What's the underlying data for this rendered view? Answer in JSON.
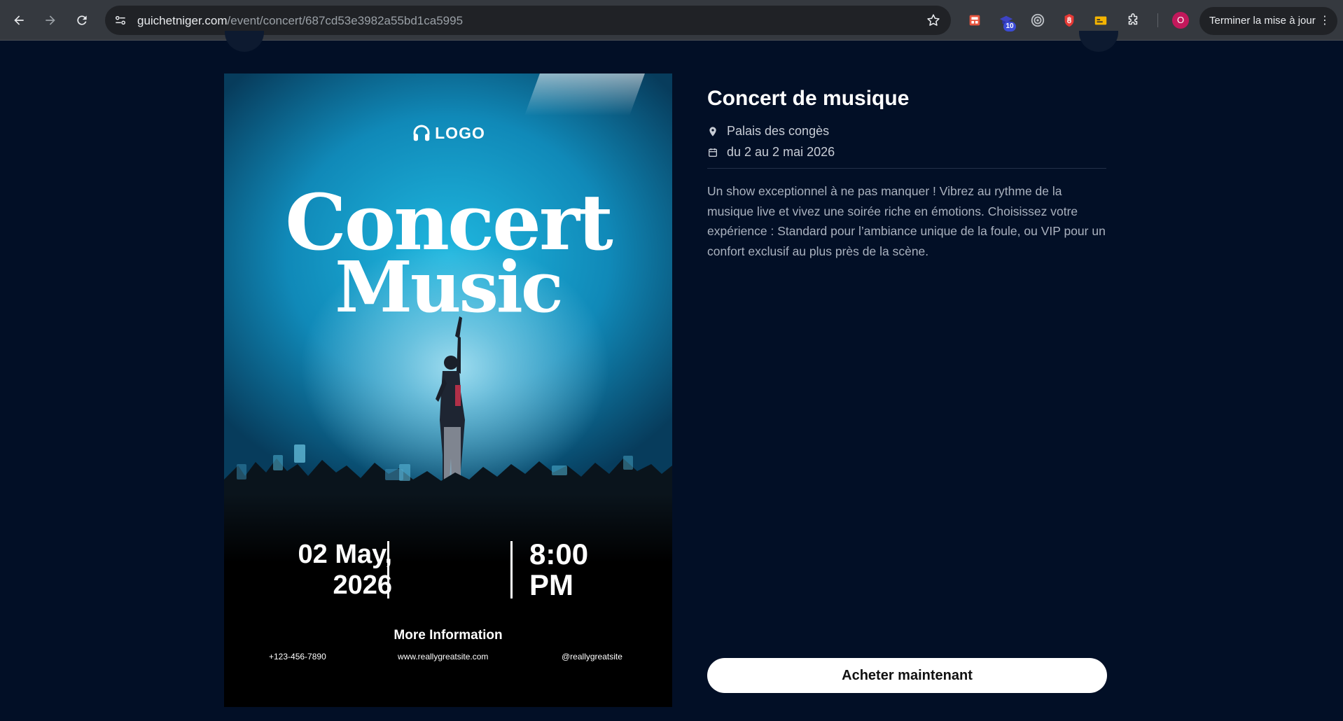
{
  "browser": {
    "url_domain": "guichetniger.com",
    "url_path": "/event/concert/687cd53e3982a55bd1ca5995",
    "extension_badge": "10",
    "profile_initial": "O",
    "update_label": "Terminer la mise à jour",
    "icons": [
      "back-icon",
      "forward-icon",
      "reload-icon",
      "site-settings-icon",
      "bookmark-star-icon",
      "extensions-puzzle-icon",
      "more-vert-icon"
    ]
  },
  "poster": {
    "logo": "LOGO",
    "title_line1": "Concert",
    "title_line2": "Music",
    "date_line1": "02 May,",
    "date_line2": "2026",
    "time_line1": "8:00",
    "time_line2": "PM",
    "more_info": "More Information",
    "phone": "+123-456-7890",
    "website": "www.reallygreatsite.com",
    "social": "@reallygreatsite"
  },
  "event": {
    "title": "Concert de musique",
    "location": "Palais des congès",
    "dates": "du 2 au 2 mai 2026",
    "description": "Un show exceptionnel à ne pas manquer ! Vibrez au rythme de la musique live et vivez une soirée riche en émotions. Choisissez votre expérience : Standard pour l’ambiance unique de la foule, ou VIP pour un confort exclusif au plus près de la scène.",
    "buy_label": "Acheter maintenant"
  }
}
